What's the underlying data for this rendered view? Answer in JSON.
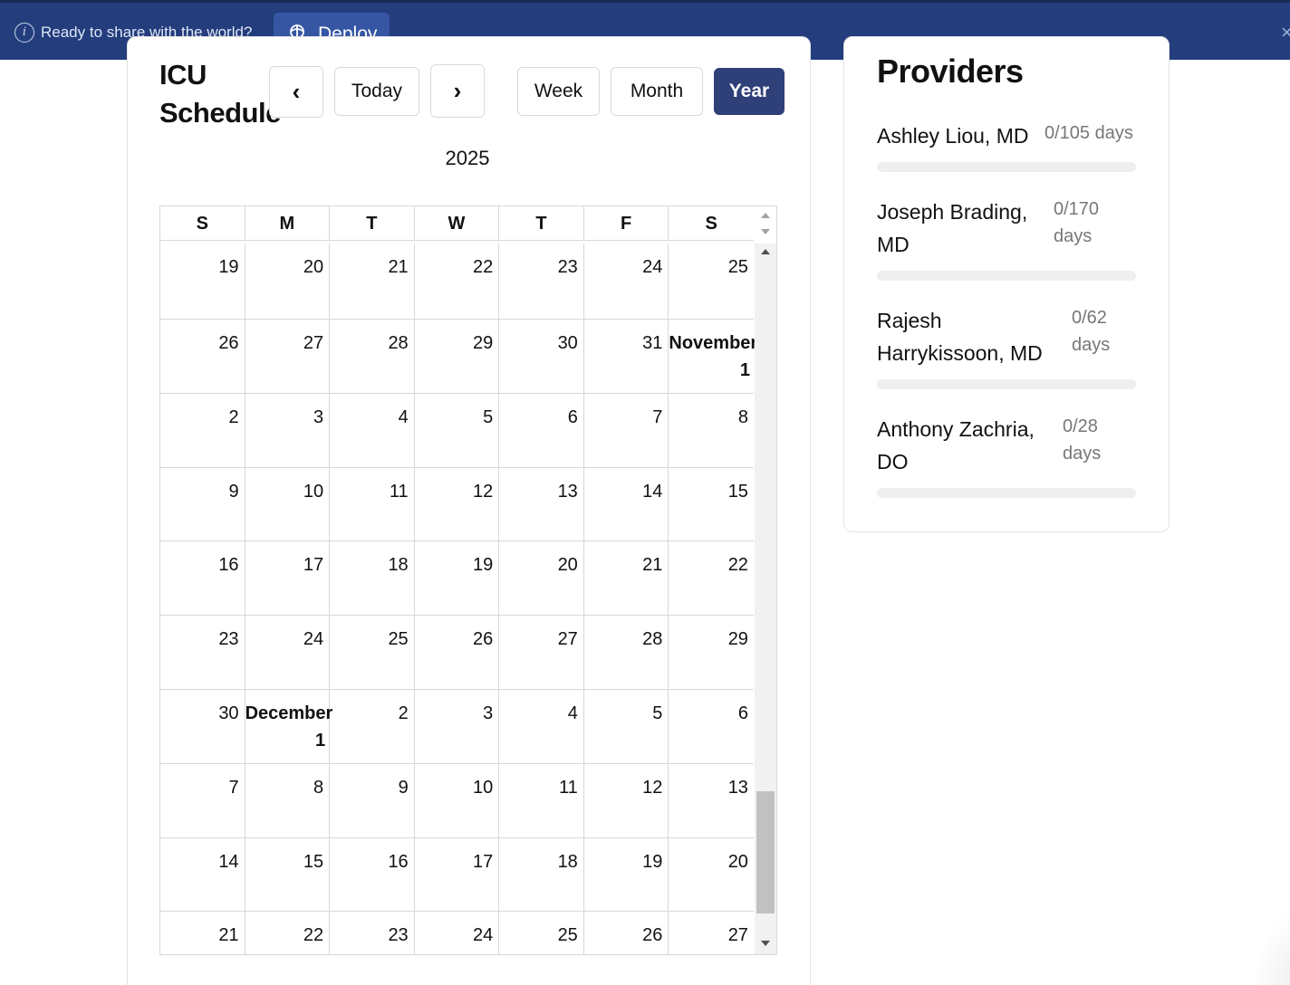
{
  "banner": {
    "message": "Ready to share with the world?",
    "deploy_label": "Deploy",
    "close_glyph": "×"
  },
  "schedule": {
    "title": "ICU Schedule",
    "prev_icon": "‹",
    "next_icon": "›",
    "today_label": "Today",
    "views": [
      "Week",
      "Month",
      "Year"
    ],
    "active_view": "Year",
    "year_label": "2025"
  },
  "calendar": {
    "weekday_headers": [
      "S",
      "M",
      "T",
      "W",
      "T",
      "F",
      "S"
    ],
    "weeks": [
      [
        {
          "d": "19"
        },
        {
          "d": "20"
        },
        {
          "d": "21"
        },
        {
          "d": "22"
        },
        {
          "d": "23"
        },
        {
          "d": "24"
        },
        {
          "d": "25"
        }
      ],
      [
        {
          "d": "26"
        },
        {
          "d": "27"
        },
        {
          "d": "28"
        },
        {
          "d": "29"
        },
        {
          "d": "30"
        },
        {
          "d": "31"
        },
        {
          "d": "1",
          "month": "November"
        }
      ],
      [
        {
          "d": "2"
        },
        {
          "d": "3"
        },
        {
          "d": "4"
        },
        {
          "d": "5"
        },
        {
          "d": "6"
        },
        {
          "d": "7"
        },
        {
          "d": "8"
        }
      ],
      [
        {
          "d": "9"
        },
        {
          "d": "10"
        },
        {
          "d": "11"
        },
        {
          "d": "12"
        },
        {
          "d": "13"
        },
        {
          "d": "14"
        },
        {
          "d": "15"
        }
      ],
      [
        {
          "d": "16"
        },
        {
          "d": "17"
        },
        {
          "d": "18"
        },
        {
          "d": "19"
        },
        {
          "d": "20"
        },
        {
          "d": "21"
        },
        {
          "d": "22"
        }
      ],
      [
        {
          "d": "23"
        },
        {
          "d": "24"
        },
        {
          "d": "25"
        },
        {
          "d": "26"
        },
        {
          "d": "27"
        },
        {
          "d": "28"
        },
        {
          "d": "29"
        }
      ],
      [
        {
          "d": "30"
        },
        {
          "d": "1",
          "month": "December"
        },
        {
          "d": "2"
        },
        {
          "d": "3"
        },
        {
          "d": "4"
        },
        {
          "d": "5"
        },
        {
          "d": "6"
        }
      ],
      [
        {
          "d": "7"
        },
        {
          "d": "8"
        },
        {
          "d": "9"
        },
        {
          "d": "10"
        },
        {
          "d": "11"
        },
        {
          "d": "12"
        },
        {
          "d": "13"
        }
      ],
      [
        {
          "d": "14"
        },
        {
          "d": "15"
        },
        {
          "d": "16"
        },
        {
          "d": "17"
        },
        {
          "d": "18"
        },
        {
          "d": "19"
        },
        {
          "d": "20"
        }
      ],
      [
        {
          "d": "21"
        },
        {
          "d": "22"
        },
        {
          "d": "23"
        },
        {
          "d": "24"
        },
        {
          "d": "25"
        },
        {
          "d": "26"
        },
        {
          "d": "27"
        }
      ]
    ]
  },
  "providers": {
    "title": "Providers",
    "items": [
      {
        "name": "Ashley Liou, MD",
        "days": "0/105 days",
        "progress": 0
      },
      {
        "name": "Joseph Brading, MD",
        "days": "0/170 days",
        "progress": 0
      },
      {
        "name": "Rajesh Harrykissoon, MD",
        "days": "0/62 days",
        "progress": 0
      },
      {
        "name": "Anthony Zachria, DO",
        "days": "0/28 days",
        "progress": 0
      }
    ]
  },
  "colors": {
    "banner_bg": "#233d7d",
    "deploy_bg": "#3656a4",
    "active_view_bg": "#2f3f78",
    "progress_track": "#efefef"
  },
  "icons": {
    "info": "info-icon",
    "deploy": "deploy-icon",
    "close": "close-icon",
    "prev": "chevron-left-icon",
    "next": "chevron-right-icon"
  }
}
